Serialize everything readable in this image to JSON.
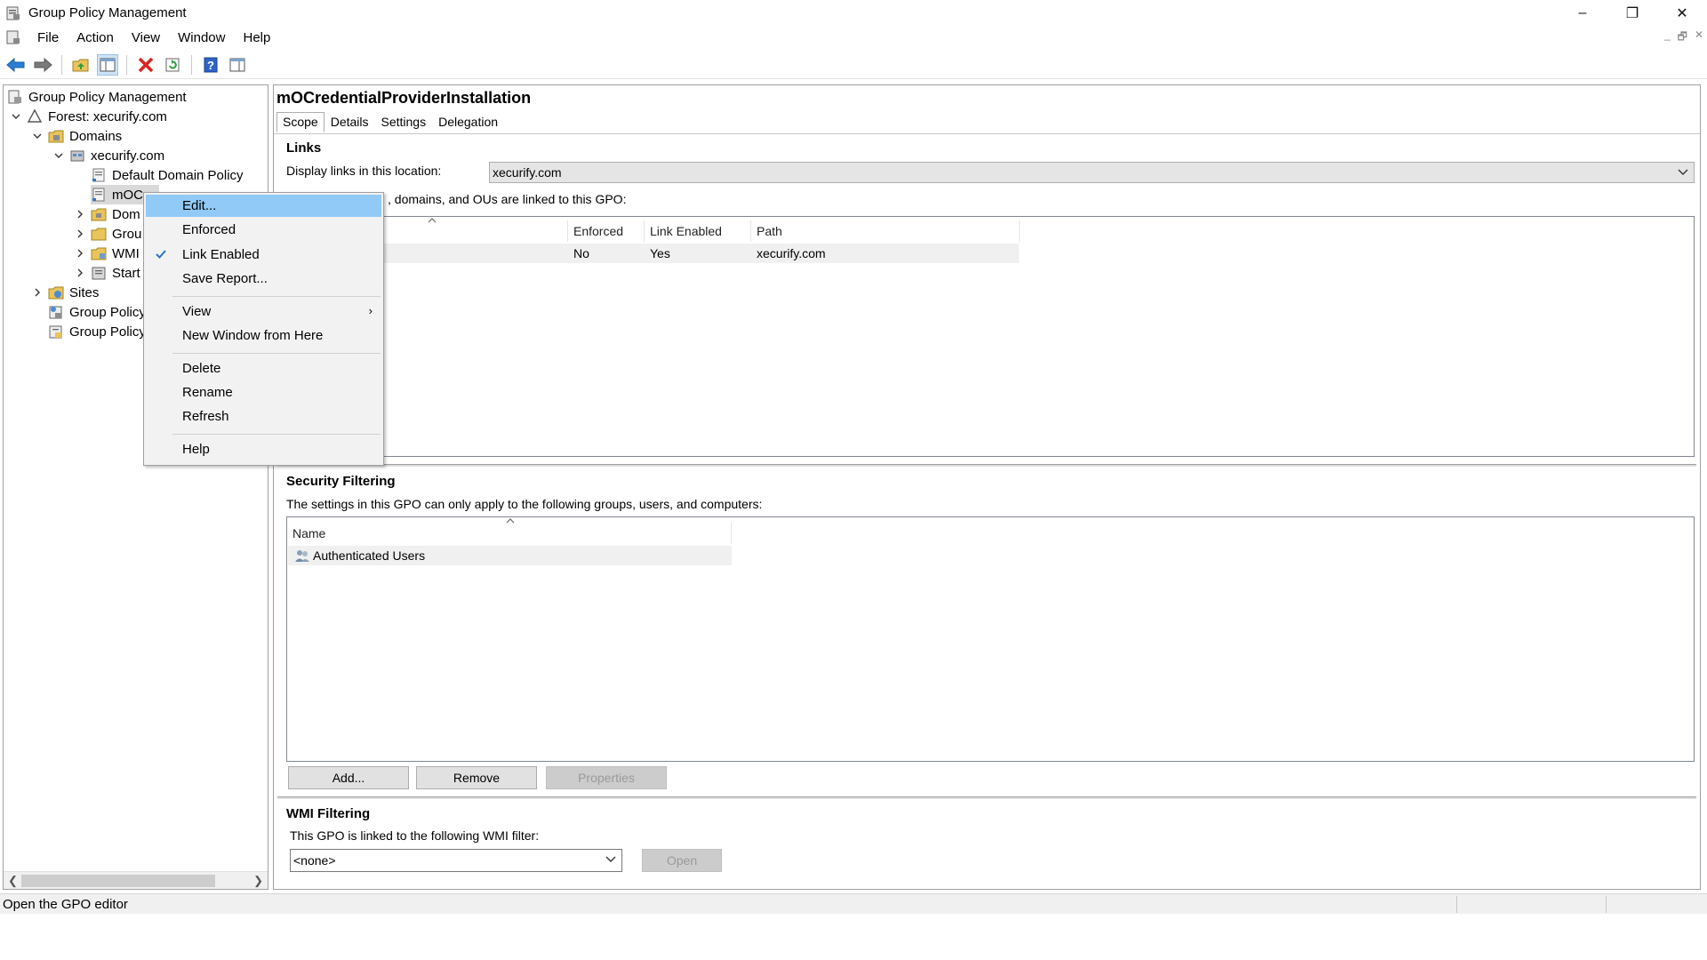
{
  "window": {
    "title": "Group Policy Management",
    "controls": {
      "minimize": "–",
      "restore": "❐",
      "close": "✕"
    }
  },
  "menubar": {
    "items": [
      "File",
      "Action",
      "View",
      "Window",
      "Help"
    ],
    "mdi": {
      "minimize": "_",
      "restore": "🗗",
      "close": "✕"
    }
  },
  "toolbar": {
    "icons": [
      "back-arrow-icon",
      "forward-arrow-icon",
      "up-folder-icon",
      "show-hide-tree-icon",
      "delete-icon",
      "refresh-icon",
      "help-icon",
      "properties-pane-icon"
    ]
  },
  "tree": {
    "items": [
      {
        "label": "Group Policy Management",
        "expander": ""
      },
      {
        "label": "Forest: xecurify.com",
        "expander": "v"
      },
      {
        "label": "Domains",
        "expander": "v"
      },
      {
        "label": "xecurify.com",
        "expander": "v"
      },
      {
        "label": "Default Domain Policy",
        "expander": ""
      },
      {
        "label": "mOC",
        "expander": ""
      },
      {
        "label": "Dom",
        "expander": ">"
      },
      {
        "label": "Grou",
        "expander": ">"
      },
      {
        "label": "WMI",
        "expander": ">"
      },
      {
        "label": "Start",
        "expander": ">"
      },
      {
        "label": "Sites",
        "expander": ">"
      },
      {
        "label": "Group Policy",
        "expander": ""
      },
      {
        "label": "Group Policy",
        "expander": ""
      }
    ]
  },
  "context_menu": {
    "items": [
      {
        "label": "Edit..."
      },
      {
        "label": "Enforced"
      },
      {
        "label": "Link Enabled"
      },
      {
        "label": "Save Report..."
      },
      {
        "label": "View"
      },
      {
        "label": "New Window from Here"
      },
      {
        "label": "Delete"
      },
      {
        "label": "Rename"
      },
      {
        "label": "Refresh"
      },
      {
        "label": "Help"
      }
    ],
    "check_glyph": "✓",
    "submenu_glyph": "›"
  },
  "details": {
    "gpo_name": "mOCredentialProviderInstallation",
    "tabs": [
      "Scope",
      "Details",
      "Settings",
      "Delegation"
    ],
    "links": {
      "title": "Links",
      "location_label": "Display links in this location:",
      "location_value": "xecurify.com",
      "description": ", domains, and OUs are linked to this GPO:",
      "columns": [
        "Enforced",
        "Link Enabled",
        "Path"
      ],
      "rows": [
        {
          "enforced": "No",
          "link_enabled": "Yes",
          "path": "xecurify.com"
        }
      ]
    },
    "security_filtering": {
      "title": "Security Filtering",
      "description": "The settings in this GPO can only apply to the following groups, users, and computers:",
      "column": "Name",
      "rows": [
        "Authenticated Users"
      ],
      "buttons": {
        "add": "Add...",
        "remove": "Remove",
        "properties": "Properties"
      }
    },
    "wmi_filtering": {
      "title": "WMI Filtering",
      "description": "This GPO is linked to the following WMI filter:",
      "value": "<none>",
      "open_button": "Open"
    }
  },
  "statusbar": {
    "text": "Open the GPO editor"
  }
}
